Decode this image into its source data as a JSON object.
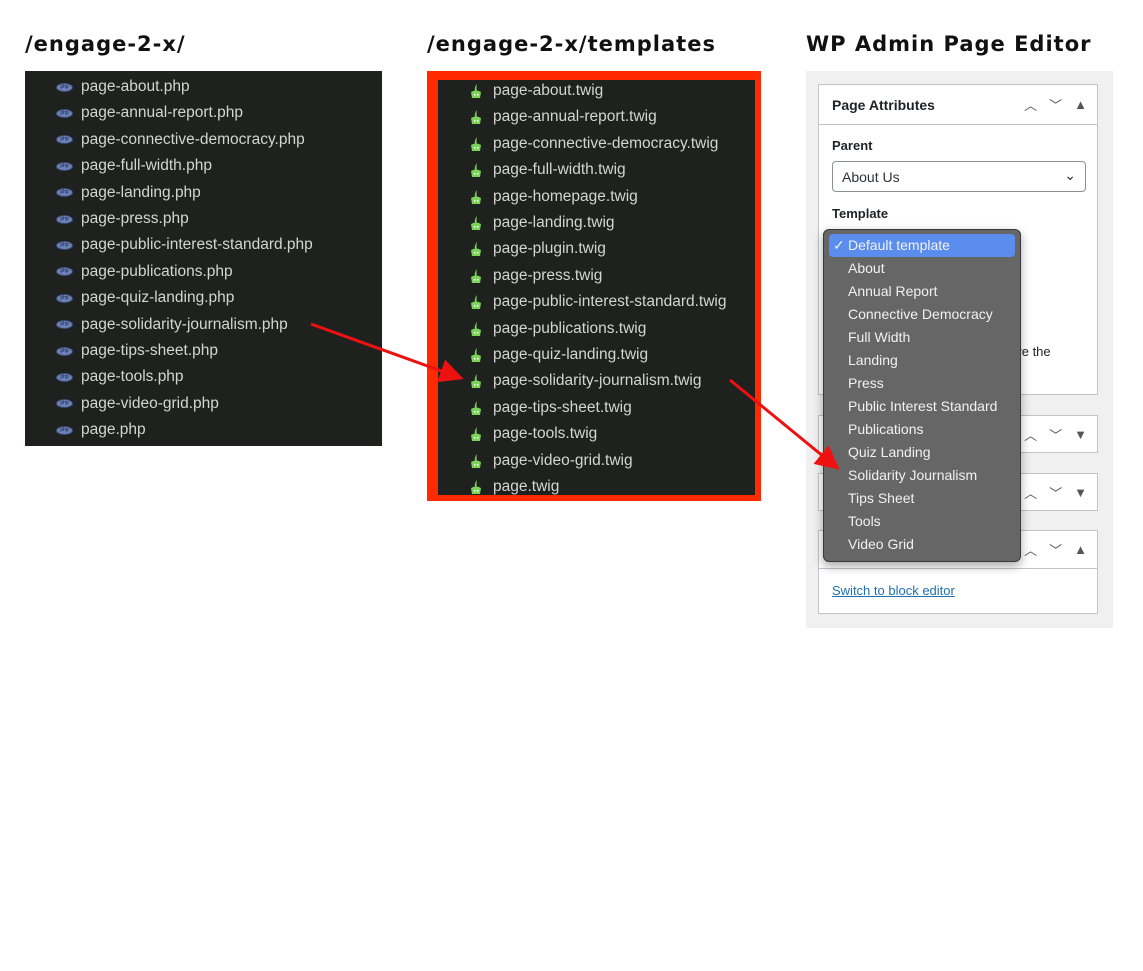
{
  "headings": {
    "php": "/engage-2-x/",
    "twig": "/engage-2-x/templates",
    "wp": "WP Admin Page Editor"
  },
  "php_files": [
    "page-about.php",
    "page-annual-report.php",
    "page-connective-democracy.php",
    "page-full-width.php",
    "page-landing.php",
    "page-press.php",
    "page-public-interest-standard.php",
    "page-publications.php",
    "page-quiz-landing.php",
    "page-solidarity-journalism.php",
    "page-tips-sheet.php",
    "page-tools.php",
    "page-video-grid.php",
    "page.php"
  ],
  "twig_files": [
    "page-about.twig",
    "page-annual-report.twig",
    "page-connective-democracy.twig",
    "page-full-width.twig",
    "page-homepage.twig",
    "page-landing.twig",
    "page-plugin.twig",
    "page-press.twig",
    "page-public-interest-standard.twig",
    "page-publications.twig",
    "page-quiz-landing.twig",
    "page-solidarity-journalism.twig",
    "page-tips-sheet.twig",
    "page-tools.twig",
    "page-video-grid.twig",
    "page.twig"
  ],
  "wp": {
    "box_title": "Page Attributes",
    "parent_label": "Parent",
    "parent_value": "About Us",
    "template_label": "Template",
    "hidden_text": "ove the",
    "template_options": [
      "Default template",
      "About",
      "Annual Report",
      "Connective Democracy",
      "Full Width",
      "Landing",
      "Press",
      "Public Interest Standard",
      "Publications",
      "Quiz Landing",
      "Solidarity Journalism",
      "Tips Sheet",
      "Tools",
      "Video Grid"
    ],
    "selected_option": "Default template",
    "switch_link": "Switch to block editor"
  },
  "colors": {
    "highlight_border": "#ff2a00",
    "arrow": "#ee1111",
    "selected": "#5b8def"
  }
}
